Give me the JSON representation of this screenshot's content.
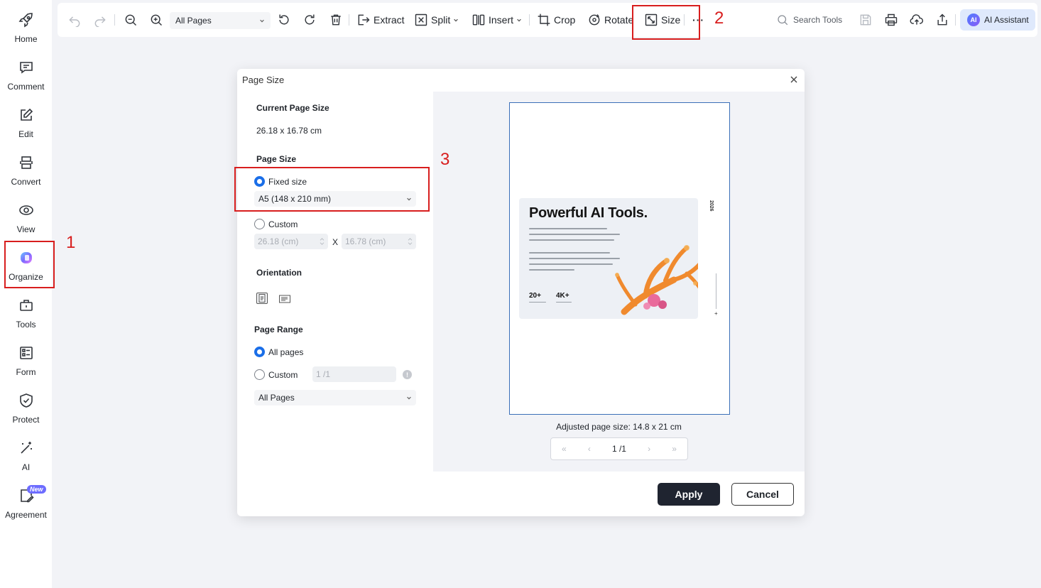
{
  "sidebar": {
    "items": [
      {
        "label": "Home",
        "icon": "rocket-icon"
      },
      {
        "label": "Comment",
        "icon": "comment-icon"
      },
      {
        "label": "Edit",
        "icon": "edit-icon"
      },
      {
        "label": "Convert",
        "icon": "convert-icon"
      },
      {
        "label": "View",
        "icon": "eye-icon"
      },
      {
        "label": "Organize",
        "icon": "organize-icon"
      },
      {
        "label": "Tools",
        "icon": "toolbox-icon"
      },
      {
        "label": "Form",
        "icon": "form-icon"
      },
      {
        "label": "Protect",
        "icon": "shield-icon"
      },
      {
        "label": "AI",
        "icon": "magic-wand-icon"
      },
      {
        "label": "Agreement",
        "icon": "agreement-icon"
      }
    ],
    "new_badge": "New"
  },
  "toolbar": {
    "pages_select": "All Pages",
    "extract": "Extract",
    "split": "Split",
    "insert": "Insert",
    "crop": "Crop",
    "rotate": "Rotate",
    "size": "Size",
    "more": "···",
    "search_tools": "Search Tools",
    "ai_assistant": "AI Assistant",
    "ai_logo": "AI"
  },
  "annotations": {
    "n1": "1",
    "n2": "2",
    "n3": "3"
  },
  "dialog": {
    "title": "Page Size",
    "current_size_title": "Current Page Size",
    "current_size_value": "26.18 x 16.78 cm",
    "page_size_title": "Page Size",
    "fixed_size_label": "Fixed size",
    "fixed_size_value": "A5 (148 x 210 mm)",
    "custom_label": "Custom",
    "custom_width": "26.18 (cm)",
    "custom_height": "16.78 (cm)",
    "x_sep": "X",
    "orientation_title": "Orientation",
    "page_range_title": "Page Range",
    "all_pages_label": "All pages",
    "range_custom_label": "Custom",
    "range_custom_placeholder": "1 /1",
    "range_select": "All Pages",
    "info_glyph": "!",
    "adjusted_label": "Adjusted page size: 14.8 x 21 cm",
    "pager": {
      "first": "«",
      "prev": "‹",
      "current": "1 /1",
      "next": "›",
      "last": "»"
    },
    "apply": "Apply",
    "cancel": "Cancel"
  },
  "preview": {
    "title": "Powerful AI Tools.",
    "stat1": "20+",
    "stat2": "4K+",
    "year": "2026"
  }
}
